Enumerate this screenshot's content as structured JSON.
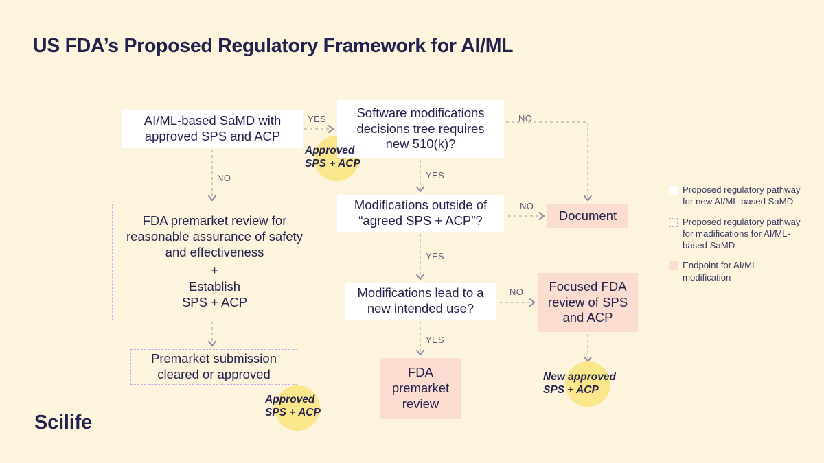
{
  "page": {
    "title": "US FDA’s Proposed Regulatory Framework for AI/ML",
    "logo": "Scilife",
    "background_color": "#FDF4DE",
    "text_color": "#23224C"
  },
  "colors": {
    "white_node": "#FFFFFF",
    "pink_node": "#FADCD1",
    "dashed_border": "#C6AAE6",
    "highlight_blob": "#FBE78B",
    "edge_line": "#B9B6A8",
    "edge_label": "#5D5C7B"
  },
  "nodes": {
    "samd": "AI/ML-based SaMD with approved SPS and ACP",
    "software_modifications": "Software modifications decisions tree requires new 510(k)?",
    "fda_premarket_review_l1": "FDA premarket review for reasonable assurance of safety and effectiveness",
    "fda_premarket_review_plus": "+",
    "fda_premarket_review_l2": "Establish",
    "fda_premarket_review_l3": "SPS + ACP",
    "premarket_submission": "Premarket submission cleared or approved",
    "modifications_outside": "Modifications outside of “agreed SPS + ACP”?",
    "document": "Document",
    "modifications_intended_use": "Modifications lead to a new intended use?",
    "focused_review": "Focused FDA review of SPS and ACP",
    "fda_premarket": "FDA premarket review"
  },
  "edge_labels": {
    "yes1": "YES",
    "no1": "NO",
    "no2": "NO",
    "yes2": "YES",
    "no3": "NO",
    "yes3": "YES",
    "no4": "NO",
    "yes4": "YES"
  },
  "callouts": {
    "approved_1_line1": "Approved",
    "approved_1_line2": "SPS + ACP",
    "approved_2_line1": "Approved",
    "approved_2_line2": "SPS + ACP",
    "new_approved_line1": "New approved",
    "new_approved_line2": "SPS + ACP"
  },
  "legend": {
    "items": [
      {
        "swatch": "white",
        "text": "Proposed regulatory pathway for new AI/ML-based SaMD"
      },
      {
        "swatch": "dashed",
        "text": "Proposed regulatory pathway for madifications for AI/ML-based SaMD"
      },
      {
        "swatch": "pink",
        "text": "Endpoint for AI/ML modification"
      }
    ]
  },
  "chart_data": {
    "type": "diagram",
    "diagram_kind": "flowchart",
    "title": "US FDA’s Proposed Regulatory Framework for AI/ML",
    "nodes": [
      {
        "id": "samd",
        "label": "AI/ML-based SaMD with approved SPS and ACP",
        "style": "white"
      },
      {
        "id": "swmod",
        "label": "Software modifications decisions tree requires new 510(k)?",
        "style": "white"
      },
      {
        "id": "fdapre",
        "label": "FDA premarket review for reasonable assurance of safety and effectiveness + Establish SPS + ACP",
        "style": "dashed"
      },
      {
        "id": "premarket",
        "label": "Premarket submission cleared or approved",
        "style": "dashed"
      },
      {
        "id": "modoutside",
        "label": "Modifications outside of “agreed SPS + ACP”?",
        "style": "white"
      },
      {
        "id": "document",
        "label": "Document",
        "style": "pink"
      },
      {
        "id": "modintended",
        "label": "Modifications lead to a new intended use?",
        "style": "white"
      },
      {
        "id": "focused",
        "label": "Focused FDA review of SPS and ACP",
        "style": "pink"
      },
      {
        "id": "fdapremkt",
        "label": "FDA premarket review",
        "style": "pink"
      }
    ],
    "edges": [
      {
        "from": "samd",
        "to": "swmod",
        "label": "YES"
      },
      {
        "from": "samd",
        "to": "fdapre",
        "label": "NO"
      },
      {
        "from": "fdapre",
        "to": "premarket",
        "label": ""
      },
      {
        "from": "swmod",
        "to": "document",
        "label": "NO"
      },
      {
        "from": "swmod",
        "to": "modoutside",
        "label": "YES"
      },
      {
        "from": "modoutside",
        "to": "document",
        "label": "NO"
      },
      {
        "from": "modoutside",
        "to": "modintended",
        "label": "YES"
      },
      {
        "from": "modintended",
        "to": "focused",
        "label": "NO"
      },
      {
        "from": "modintended",
        "to": "fdapremkt",
        "label": "YES"
      }
    ],
    "annotations": [
      {
        "near": "samd-to-swmod",
        "text": "Approved SPS + ACP"
      },
      {
        "near": "premarket",
        "text": "Approved SPS + ACP"
      },
      {
        "near": "focused",
        "text": "New approved SPS + ACP"
      }
    ]
  }
}
